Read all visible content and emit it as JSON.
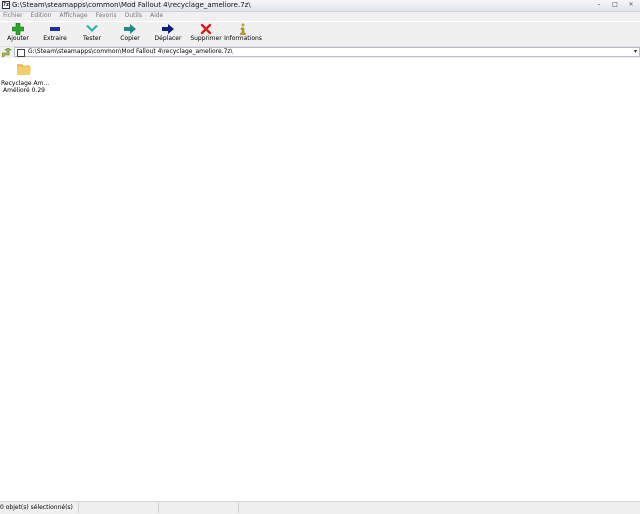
{
  "window": {
    "title": "G:\\Steam\\steamapps\\common\\Mod Fallout 4\\recyclage_ameliore.7z\\",
    "app_icon_text": "7z",
    "minimize": "–",
    "maximize": "□",
    "close": "✕"
  },
  "menu": [
    "Fichier",
    "Edition",
    "Affichage",
    "Favoris",
    "Outils",
    "Aide"
  ],
  "toolbar": {
    "add": "Ajouter",
    "extract": "Extraire",
    "test": "Tester",
    "copy": "Copier",
    "move": "Déplacer",
    "delete": "Supprimer",
    "info": "Informations"
  },
  "address": {
    "path": "G:\\Steam\\steamapps\\common\\Mod Fallout 4\\recyclage_ameliore.7z\\",
    "dropdown": "▾"
  },
  "files": [
    {
      "name_line1": "Recyclage Am...",
      "name_line2": "Amélioré 0.29",
      "icon": "folder-icon"
    }
  ],
  "status": {
    "selection": "0 objet(s) sélectionné(s)"
  },
  "colors": {
    "add_green": "#2fa32f",
    "extract_blue": "#1a2fa0",
    "test_teal": "#26b3a8",
    "copy_teal": "#1e8c84",
    "move_navy": "#0d1f7a",
    "delete_red": "#d61e1e",
    "info_gold": "#c7a21a",
    "folder_yellow": "#f2cf6b"
  }
}
